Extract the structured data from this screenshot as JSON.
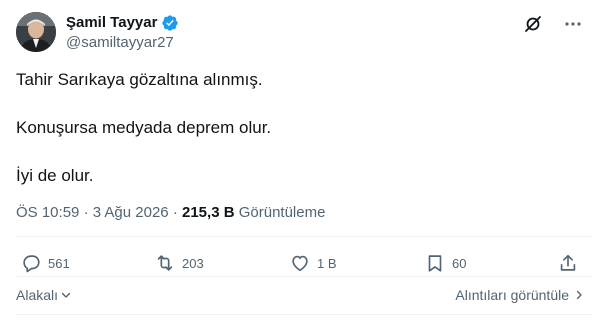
{
  "author": {
    "display_name": "Şamil Tayyar",
    "handle": "@samiltayyar27",
    "verified": true
  },
  "tweet": {
    "paragraphs": [
      "Tahir Sarıkaya gözaltına alınmış.",
      "Konuşursa medyada deprem olur.",
      "İyi de olur."
    ],
    "time": "ÖS 10:59",
    "separator": "·",
    "date": "3 Ağu 2026",
    "views_count": "215,3 B",
    "views_label": "Görüntüleme"
  },
  "actions": {
    "replies": "561",
    "retweets": "203",
    "likes": "1 B",
    "bookmarks": "60"
  },
  "footer": {
    "sort_label": "Alakalı",
    "quotes_link": "Alıntıları görüntüle"
  },
  "colors": {
    "verified_blue": "#1d9bf0",
    "text_primary": "#0f1419",
    "text_secondary": "#536471"
  },
  "icons": {
    "grok": "grok-icon",
    "more": "more-icon",
    "verified": "verified-badge-icon",
    "reply": "reply-icon",
    "retweet": "retweet-icon",
    "like": "heart-icon",
    "bookmark": "bookmark-icon",
    "share": "share-icon"
  }
}
